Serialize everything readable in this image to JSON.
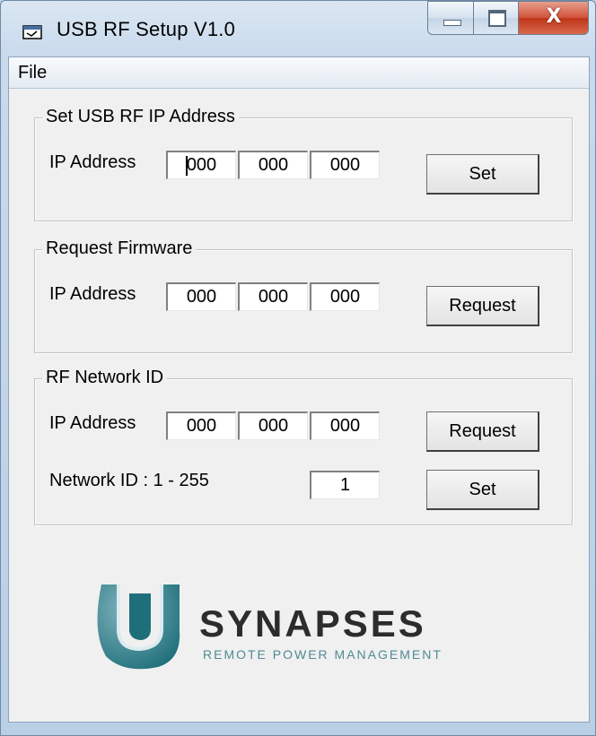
{
  "window": {
    "title": "USB RF Setup V1.0",
    "app_icon": "app-window-icon",
    "close_glyph": "X"
  },
  "menu": {
    "file": "File"
  },
  "set_ip": {
    "legend": "Set USB RF IP Address",
    "ip_label": "IP Address",
    "octets": [
      "000",
      "000",
      "000"
    ],
    "button": "Set"
  },
  "firmware": {
    "legend": "Request Firmware",
    "ip_label": "IP Address",
    "octets": [
      "000",
      "000",
      "000"
    ],
    "button": "Request"
  },
  "network": {
    "legend": "RF Network ID",
    "ip_label": "IP Address",
    "octets": [
      "000",
      "000",
      "000"
    ],
    "request_button": "Request",
    "netid_label": "Network ID : 1  - 255",
    "netid_value": "1",
    "set_button": "Set"
  },
  "logo": {
    "name": "SYNAPSES",
    "tagline": "REMOTE POWER MANAGEMENT",
    "color": "#1f6f7b"
  }
}
